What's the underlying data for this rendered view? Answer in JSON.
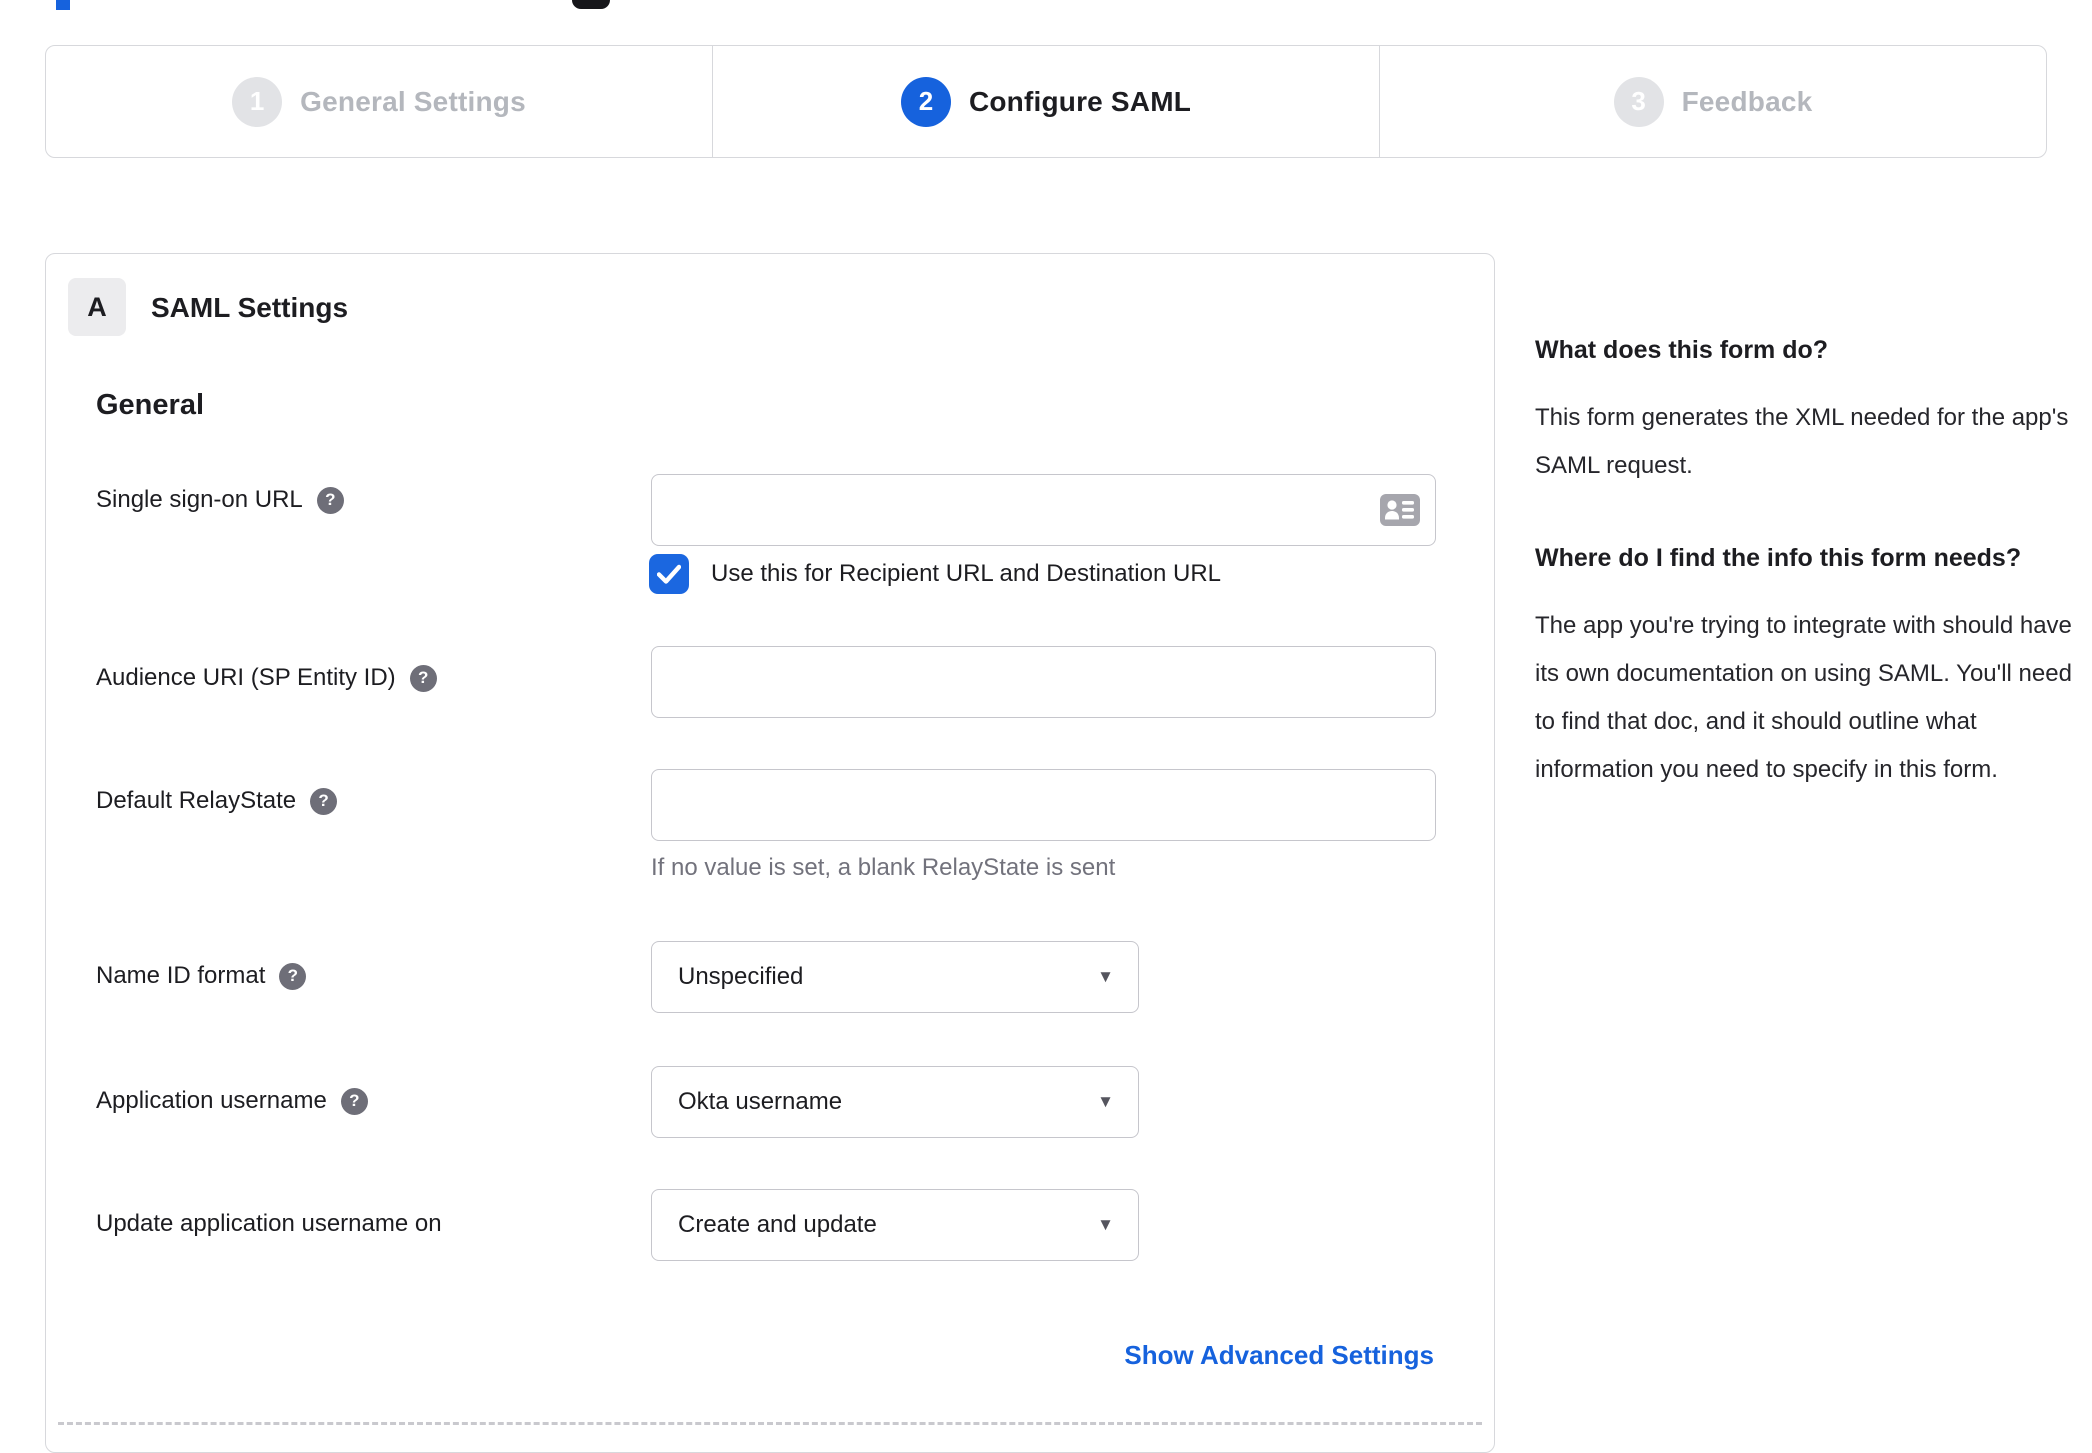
{
  "colors": {
    "accent_blue": "#1662dd",
    "checkbox_blue": "#1b67e0",
    "inactive_gray": "#e2e3e6",
    "text_dark": "#1d1d21",
    "hint_gray": "#72727c"
  },
  "stepper": {
    "steps": [
      {
        "number": "1",
        "label": "General Settings",
        "state": "inactive"
      },
      {
        "number": "2",
        "label": "Configure SAML",
        "state": "active"
      },
      {
        "number": "3",
        "label": "Feedback",
        "state": "inactive"
      }
    ]
  },
  "panel": {
    "section_badge": "A",
    "section_title": "SAML Settings",
    "group_title": "General",
    "fields": [
      {
        "label": "Single sign-on URL",
        "type": "text",
        "value": "",
        "checkbox_label": "Use this for Recipient URL and Destination URL",
        "checkbox_checked": true
      },
      {
        "label": "Audience URI (SP Entity ID)",
        "type": "text",
        "value": ""
      },
      {
        "label": "Default RelayState",
        "type": "text",
        "value": "",
        "hint": "If no value is set, a blank RelayState is sent"
      },
      {
        "label": "Name ID format",
        "type": "select",
        "value": "Unspecified"
      },
      {
        "label": "Application username",
        "type": "select",
        "value": "Okta username"
      },
      {
        "label": "Update application username on",
        "type": "select",
        "value": "Create and update"
      }
    ],
    "advanced_link": "Show Advanced Settings"
  },
  "sidebar": {
    "blocks": [
      {
        "heading": "What does this form do?",
        "body": "This form generates the XML needed for the app's SAML request."
      },
      {
        "heading": "Where do I find the info this form needs?",
        "body": "The app you're trying to integrate with should have its own documentation on using SAML. You'll need to find that doc, and it should outline what information you need to specify in this form."
      }
    ]
  }
}
